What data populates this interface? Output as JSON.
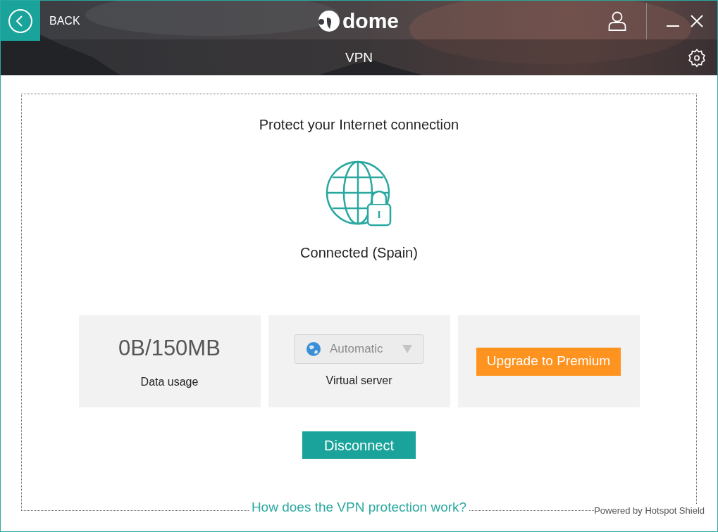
{
  "header": {
    "back_label": "BACK",
    "logo_text": "dome",
    "section_title": "VPN"
  },
  "heading": "Protect your Internet connection",
  "status": "Connected (Spain)",
  "cards": [
    {
      "kind": "usage",
      "value": "0B/150MB",
      "label": "Data usage"
    },
    {
      "kind": "server",
      "value": "Automatic",
      "disabled": true,
      "label": "Virtual server"
    },
    {
      "kind": "upgrade",
      "value": "Upgrade to Premium"
    }
  ],
  "disconnect": "Disconnect",
  "help_link": "How does the VPN protection work?",
  "powered_by": "Powered by Hotspot Shield"
}
